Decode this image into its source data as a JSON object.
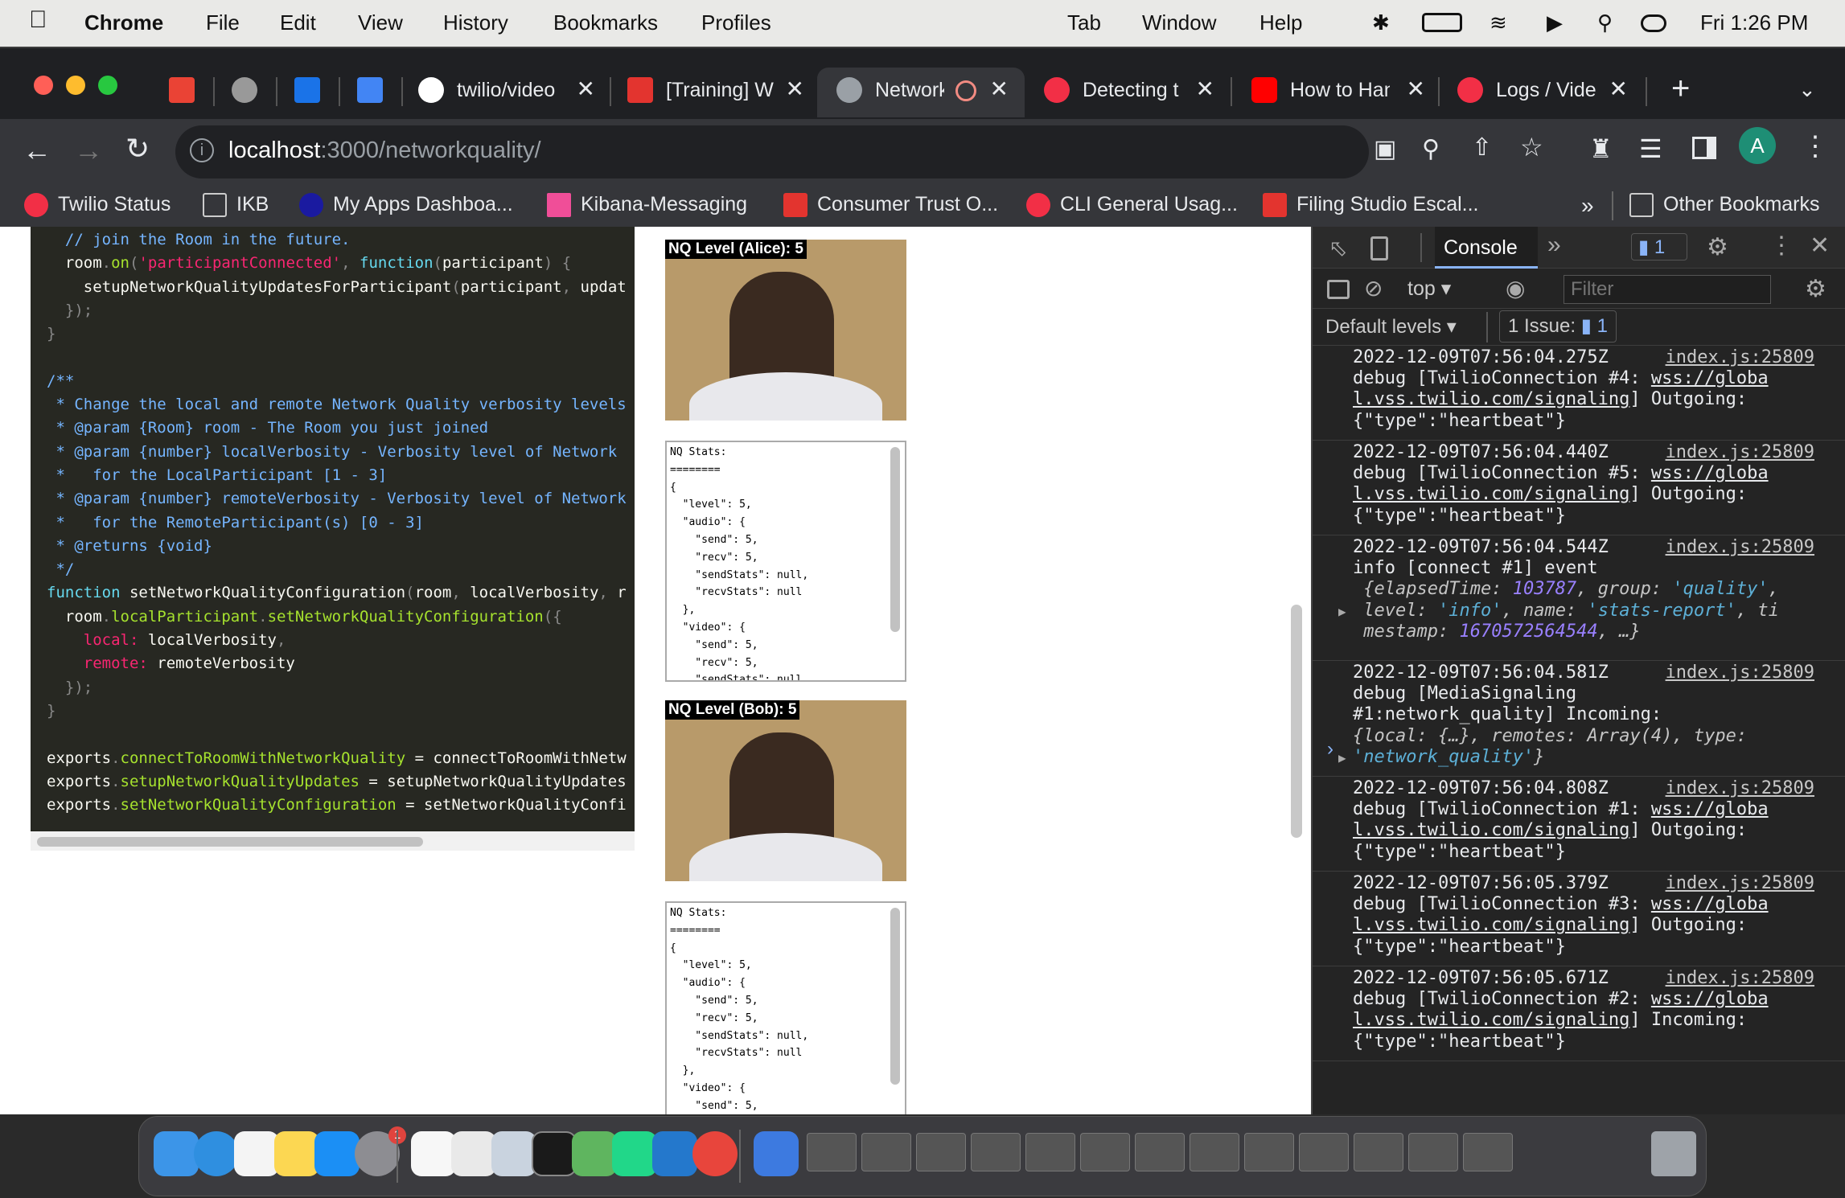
{
  "menubar": {
    "app": "Chrome",
    "items": [
      "File",
      "Edit",
      "View",
      "History",
      "Bookmarks",
      "Profiles",
      "Tab",
      "Window",
      "Help"
    ],
    "clock": "Fri  1:26 PM"
  },
  "tabs": [
    {
      "title": "",
      "icon": "gmail-icon",
      "color": "#ea4335"
    },
    {
      "title": "",
      "icon": "pinned-app-icon",
      "color": "#999999"
    },
    {
      "title": "",
      "icon": "calendar-icon",
      "color": "#1a73e8"
    },
    {
      "title": "",
      "icon": "docs-icon",
      "color": "#4285f4"
    },
    {
      "title": "twilio/video",
      "icon": "github-icon",
      "color": "#ffffff"
    },
    {
      "title": "[Training] W",
      "icon": "jira-icon",
      "color": "#e3342f"
    },
    {
      "title": "Network",
      "icon": "globe-icon",
      "color": "#9aa0a6"
    },
    {
      "title": "Detecting t",
      "icon": "twilio-icon",
      "color": "#f22f46"
    },
    {
      "title": "How to Han",
      "icon": "youtube-icon",
      "color": "#ff0000"
    },
    {
      "title": "Logs / Vide",
      "icon": "twilio-icon",
      "color": "#f22f46"
    }
  ],
  "omnibox": {
    "host": "localhost",
    "path": ":3000/networkquality/"
  },
  "profile_initial": "A",
  "bookmarks": [
    {
      "label": "Twilio Status",
      "color": "#f22f46"
    },
    {
      "label": "IKB",
      "color": "#cccccc"
    },
    {
      "label": "My Apps Dashboa...",
      "color": "#1a1aa0"
    },
    {
      "label": "Kibana-Messaging",
      "color": "#f04e98"
    },
    {
      "label": "Consumer Trust O...",
      "color": "#e3342f"
    },
    {
      "label": "CLI General Usag...",
      "color": "#f22f46"
    },
    {
      "label": "Filing Studio Escal...",
      "color": "#e3342f"
    },
    {
      "label": "Other Bookmarks",
      "color": "#cccccc"
    }
  ],
  "code_lines": [
    "  // join the Room in the future.",
    "  room.on('participantConnected', function(participant) {",
    "    setupNetworkQualityUpdatesForParticipant(participant, updat",
    "  });",
    "}",
    "",
    "/**",
    " * Change the local and remote Network Quality verbosity levels",
    " * @param {Room} room - The Room you just joined",
    " * @param {number} localVerbosity - Verbosity level of Network",
    " *   for the LocalParticipant [1 - 3]",
    " * @param {number} remoteVerbosity - Verbosity level of Network",
    " *   for the RemoteParticipant(s) [0 - 3]",
    " * @returns {void}",
    " */",
    "function setNetworkQualityConfiguration(room, localVerbosity, r",
    "  room.localParticipant.setNetworkQualityConfiguration({",
    "    local: localVerbosity,",
    "    remote: remoteVerbosity",
    "  });",
    "}",
    "",
    "exports.connectToRoomWithNetworkQuality = connectToRoomWithNetw",
    "exports.setupNetworkQualityUpdates = setupNetworkQualityUpdates",
    "exports.setNetworkQualityConfiguration = setNetworkQualityConfi"
  ],
  "videos": [
    {
      "label": "NQ Level (Alice): 5"
    },
    {
      "label": "NQ Level (Bob): 5"
    }
  ],
  "stats_text": "NQ Stats:\n========\n{\n  \"level\": 5,\n  \"audio\": {\n    \"send\": 5,\n    \"recv\": 5,\n    \"sendStats\": null,\n    \"recvStats\": null\n  },\n  \"video\": {\n    \"send\": 5,\n    \"recv\": 5,\n    \"sendStats\": null,",
  "stats_text_2": "NQ Stats:\n========\n{\n  \"level\": 5,\n  \"audio\": {\n    \"send\": 5,\n    \"recv\": 5,\n    \"sendStats\": null,\n    \"recvStats\": null\n  },\n  \"video\": {\n    \"send\": 5,",
  "devtools": {
    "tab_console": "Console",
    "message_count": "1",
    "context": "top",
    "filter_placeholder": "Filter",
    "levels": "Default levels",
    "issues_label": "1 Issue:",
    "issues_count": "1"
  },
  "logs": [
    {
      "ts": "2022-12-09T07:56:04.275Z",
      "src": "index.js:25809",
      "pre": "debug [TwilioConnection #4: ",
      "link1": "wss://globa",
      "link2": "l.vss.twilio.com/signaling",
      "post": "] Outgoing:",
      "tail": "{\"type\":\"heartbeat\"}"
    },
    {
      "ts": "2022-12-09T07:56:04.440Z",
      "src": "index.js:25809",
      "pre": "debug [TwilioConnection #5: ",
      "link1": "wss://globa",
      "link2": "l.vss.twilio.com/signaling",
      "post": "] Outgoing:",
      "tail": "{\"type\":\"heartbeat\"}"
    },
    {
      "ts": "2022-12-09T07:56:04.544Z",
      "src": "index.js:25809",
      "line1": "info [connect #1] event",
      "k1": "elapsedTime",
      "v1": "103787",
      "k2": "group",
      "v2": "'quality'",
      "k3": "level",
      "v3": "'info'",
      "k4": "name",
      "v4": "'stats-report'",
      "k5": "ti",
      "k6": "mestamp",
      "v6": "1670572564544",
      "ell": "…}"
    },
    {
      "ts": "2022-12-09T07:56:04.581Z",
      "src": "index.js:25809",
      "line1": "debug [MediaSignaling",
      "line2": "#1:network_quality] Incoming:",
      "k1": "local",
      "v1": "{…}",
      "k2": "remotes",
      "v2": "Array(4)",
      "k3": "type",
      "v3": "'network_quality'"
    },
    {
      "ts": "2022-12-09T07:56:04.808Z",
      "src": "index.js:25809",
      "pre": "debug [TwilioConnection #1: ",
      "link1": "wss://globa",
      "link2": "l.vss.twilio.com/signaling",
      "post": "] Outgoing:",
      "tail": "{\"type\":\"heartbeat\"}"
    },
    {
      "ts": "2022-12-09T07:56:05.379Z",
      "src": "index.js:25809",
      "pre": "debug [TwilioConnection #3: ",
      "link1": "wss://globa",
      "link2": "l.vss.twilio.com/signaling",
      "post": "] Outgoing:",
      "tail": "{\"type\":\"heartbeat\"}"
    },
    {
      "ts": "2022-12-09T07:56:05.671Z",
      "src": "index.js:25809",
      "pre": "debug [TwilioConnection #2: ",
      "link1": "wss://globa",
      "link2": "l.vss.twilio.com/signaling",
      "post": "] Incoming:",
      "tail": "{\"type\":\"heartbeat\"}"
    }
  ],
  "dock": {
    "badge_settings": "1",
    "apps": [
      "finder-icon",
      "safari-icon",
      "reminders-icon",
      "notes-icon",
      "app-store-icon",
      "system-settings-icon",
      "slack-icon",
      "textedit-icon",
      "preview-icon",
      "terminal-icon",
      "atom-icon",
      "pycharm-icon",
      "vscode-icon",
      "chrome-icon",
      "xcode-icon"
    ]
  }
}
